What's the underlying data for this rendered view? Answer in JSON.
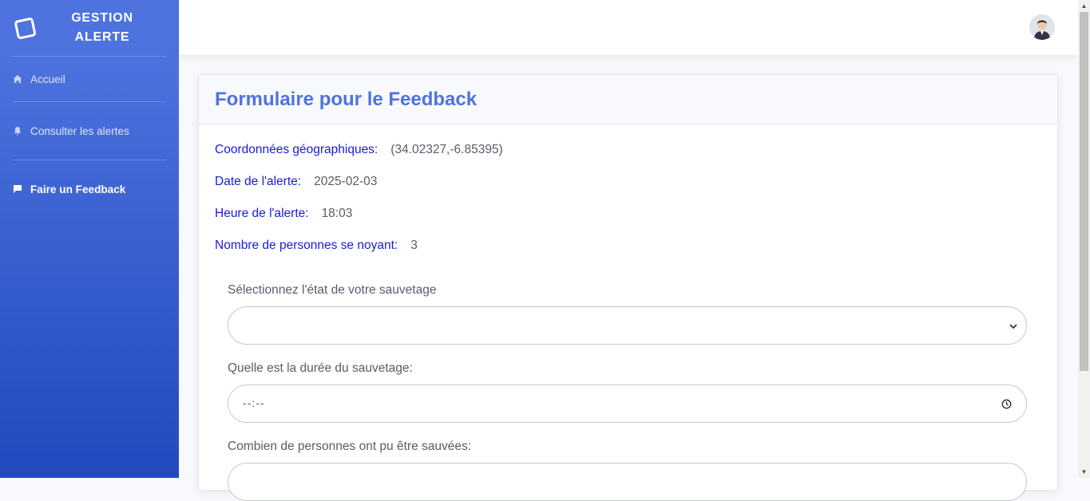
{
  "sidebar": {
    "brand_line1": "GESTION",
    "brand_line2": "ALERTE",
    "items": [
      {
        "label": "Accueil",
        "icon": "home-icon"
      },
      {
        "label": "Consulter les alertes",
        "icon": "bell-icon"
      },
      {
        "label": "Faire un Feedback",
        "icon": "comment-icon",
        "active": true
      }
    ]
  },
  "topbar": {
    "avatar": "user-avatar"
  },
  "card": {
    "title": "Formulaire pour le Feedback",
    "info": [
      {
        "label": "Coordonnées géographiques:",
        "value": "(34.02327,-6.85395)"
      },
      {
        "label": "Date de l'alerte:",
        "value": "2025-02-03"
      },
      {
        "label": "Heure de l'alerte:",
        "value": "18:03"
      },
      {
        "label": "Nombre de personnes se noyant:",
        "value": "3"
      }
    ],
    "form": {
      "state_label": "Sélectionnez l'état de votre sauvetage",
      "state_value": "",
      "duration_label": "Quelle est la durée du sauvetage:",
      "duration_placeholder": "--:--",
      "saved_label": "Combien de personnes ont pu être sauvées:"
    }
  },
  "colors": {
    "primary": "#4e73df",
    "primary_dark": "#224abe",
    "info_label": "#1b1bd6"
  }
}
